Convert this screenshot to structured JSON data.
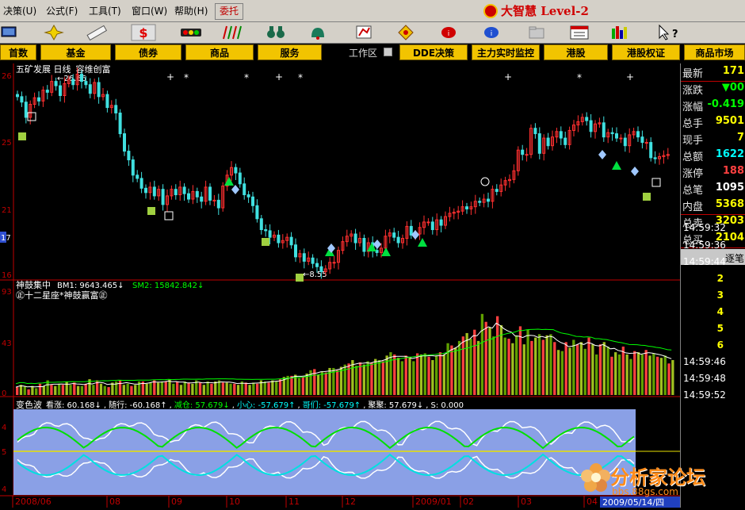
{
  "menu": {
    "items": [
      "决策(U)",
      "公式(F)",
      "工具(T)",
      "窗口(W)",
      "帮助(H)"
    ],
    "weituo": "委托",
    "brand": "大智慧 Level-2"
  },
  "toolbar": {
    "icons": [
      "monitor-icon",
      "cross-cursor-icon",
      "ruler-icon",
      "dollar-icon",
      "traffic-light-icon",
      "candle-bars-icon",
      "binoculars-icon",
      "bell-icon",
      "chart-tag-icon",
      "diamond-icon",
      "bubble-icon",
      "info-icon",
      "folder-icon",
      "window-icon",
      "color-bars-icon",
      "help-arrow-icon"
    ]
  },
  "nav": {
    "buttons": [
      "首数",
      "基金",
      "债券",
      "商品",
      "服务"
    ],
    "workspace": "工作区",
    "right_buttons": [
      "DDE决策",
      "主力实时监控",
      "港股",
      "港股权证",
      "商品市场"
    ]
  },
  "chart_data": [
    {
      "type": "candlestick",
      "title": "五矿发展 日线",
      "indicator": "容维创富",
      "annotations": [
        {
          "text": "←26.66",
          "note": "period high"
        },
        {
          "text": "←8.55",
          "note": "period low"
        }
      ],
      "price_axis_labels": [
        "26",
        "25",
        "21",
        "17",
        "16"
      ],
      "ylim": [
        8.0,
        27.5
      ],
      "closes": [
        24.6,
        24.1,
        22.7,
        23.9,
        24.5,
        24.2,
        25.2,
        25.0,
        26.0,
        25.6,
        24.7,
        25.8,
        26.2,
        25.7,
        26.66,
        26.0,
        25.7,
        24.9,
        25.9,
        24.6,
        24.8,
        23.6,
        23.8,
        23.1,
        21.2,
        19.6,
        18.8,
        17.4,
        17.1,
        16.2,
        15.8,
        16.3,
        15.5,
        16.1,
        14.7,
        15.5,
        16.1,
        15.6,
        16.3,
        15.7,
        15.2,
        15.9,
        15.4,
        15.0,
        16.3,
        15.1,
        15.1,
        14.4,
        16.4,
        17.4,
        18.1,
        17.6,
        16.6,
        15.6,
        15.4,
        14.6,
        13.4,
        12.4,
        12.3,
        11.7,
        11.9,
        11.2,
        11.4,
        11.7,
        11.0,
        9.9,
        10.2,
        9.5,
        9.8,
        9.3,
        9.0,
        8.55,
        8.8,
        9.4,
        9.4,
        10.5,
        11.3,
        11.8,
        12.0,
        11.2,
        11.6,
        10.4,
        11.2,
        10.5,
        10.3,
        10.7,
        11.8,
        12.1,
        11.7,
        11.2,
        11.6,
        12.7,
        11.9,
        12.0,
        12.6,
        13.1,
        13.1,
        12.4,
        13.3,
        12.8,
        13.6,
        13.9,
        14.0,
        14.1,
        14.5,
        14.3,
        14.5,
        15.0,
        14.9,
        15.2,
        15.0,
        16.1,
        15.9,
        16.5,
        16.9,
        17.0,
        17.8,
        19.7,
        19.3,
        19.3,
        21.7,
        21.2,
        19.4,
        20.8,
        20.1,
        20.9,
        21.4,
        20.8,
        20.2,
        21.5,
        22.0,
        22.3,
        22.7,
        22.4,
        21.4,
        22.1,
        22.2,
        20.9,
        21.3,
        21.2,
        20.8,
        20.8,
        20.1,
        21.1,
        21.4,
        20.9,
        20.4,
        20.4,
        19.0,
        18.9,
        19.1,
        19.2,
        19.3
      ],
      "buy_markers": [
        "square",
        "triangle",
        "diamond"
      ],
      "sell_markers": [
        "star",
        "cross"
      ]
    },
    {
      "type": "bar+line",
      "title": "神鼓集中",
      "legend": [
        {
          "text": "BM1: 9643.465↓",
          "color": "#ffffff"
        },
        {
          "text": "SM2: 15842.842↓",
          "color": "#00ff00"
        }
      ],
      "subtitle": "㊣十二星座*神鼓赢富㊣",
      "axis_labels": [
        "93",
        "43",
        "0"
      ],
      "volume": [
        7,
        9,
        8,
        5,
        8,
        6,
        10,
        8,
        13,
        9,
        8,
        10,
        9,
        12,
        9,
        11,
        8,
        8,
        10,
        14,
        9,
        13,
        10,
        8,
        7,
        11,
        12,
        13,
        9,
        10,
        8,
        9,
        12,
        12,
        10,
        11,
        13,
        11,
        12,
        12,
        14,
        10,
        12,
        9,
        12,
        11,
        10,
        13,
        11,
        9,
        12,
        10,
        12,
        13,
        11,
        11,
        10,
        10,
        9,
        12,
        11,
        9,
        11,
        10,
        13,
        12,
        11,
        13,
        12,
        14,
        16,
        17,
        17,
        18,
        15,
        16,
        19,
        22,
        23,
        18,
        21,
        20,
        24,
        24,
        22,
        25,
        27,
        28,
        31,
        26,
        29,
        27,
        30,
        29,
        32,
        31,
        30,
        35,
        38,
        36,
        33,
        30,
        35,
        34,
        30,
        37,
        36,
        37,
        34,
        31,
        35,
        38,
        36,
        46,
        44,
        42,
        48,
        52,
        55,
        50,
        58,
        48,
        72,
        65,
        60,
        52,
        70,
        62,
        51,
        50,
        46,
        53,
        61,
        45,
        58,
        48,
        51,
        54,
        49,
        53,
        54,
        47,
        40,
        39,
        47,
        42,
        49,
        45,
        47,
        41,
        51,
        45,
        36,
        45,
        47,
        43,
        34,
        38,
        36,
        43,
        36,
        32,
        39,
        38,
        36,
        40,
        35,
        37,
        34,
        33,
        35,
        28,
        31
      ]
    },
    {
      "type": "oscillator",
      "title": "变色波",
      "legend": [
        {
          "text": "看涨: 60.168↓",
          "color": "#ffffff"
        },
        {
          "text": "随行: -60.168↑",
          "color": "#ffffff"
        },
        {
          "text": "减仓: 57.679↓",
          "color": "#00ff00"
        },
        {
          "text": "小心: -57.679↑",
          "color": "#00ffff"
        },
        {
          "text": "哥们: -57.679↑",
          "color": "#00ffff"
        },
        {
          "text": "聚聚: 57.679↓",
          "color": "#ffffff"
        },
        {
          "text": "S: 0.000",
          "color": "#ffffff"
        }
      ],
      "axis_labels": [
        "4",
        "5",
        "4"
      ]
    }
  ],
  "x_axis": {
    "labels": [
      "2008/06",
      "08",
      "09",
      "10",
      "11",
      "12",
      "2009/01",
      "02",
      "03",
      "04"
    ],
    "current_date": "2009/05/14/四"
  },
  "quote_panel": {
    "rows": [
      {
        "label": "最新",
        "value": "171",
        "color": "#ffff00"
      },
      {
        "label": "涨跌",
        "value": "▼00",
        "color": "#00ff00"
      },
      {
        "label": "涨幅",
        "value": "-0.419",
        "color": "#00ff00"
      },
      {
        "label": "总手",
        "value": "9501",
        "color": "#ffff00"
      },
      {
        "label": "现手",
        "value": "7",
        "color": "#ffff00"
      },
      {
        "label": "总额",
        "value": "1622",
        "color": "#00ffff"
      },
      {
        "label": "涨停",
        "value": "188",
        "color": "#ff4040"
      },
      {
        "label": "总笔",
        "value": "1095",
        "color": "#ffffff"
      },
      {
        "label": "内盘",
        "value": "5368",
        "color": "#ffff00"
      },
      {
        "label": "总卖",
        "value": "3203",
        "color": "#ffff00"
      },
      {
        "label": "总买",
        "value": "2104",
        "color": "#ffff00"
      }
    ],
    "tick_header": "逐笔",
    "ticks": [
      {
        "time": "14:59:32",
        "vol": ""
      },
      {
        "time": "14:59:36",
        "vol": ""
      },
      {
        "time": "14:59:44",
        "vol": ""
      },
      {
        "time": "",
        "vol": "2"
      },
      {
        "time": "",
        "vol": "3"
      },
      {
        "time": "",
        "vol": "4"
      },
      {
        "time": "",
        "vol": "5"
      },
      {
        "time": "",
        "vol": "6"
      },
      {
        "time": "14:59:46",
        "vol": ""
      },
      {
        "time": "14:59:48",
        "vol": ""
      },
      {
        "time": "14:59:52",
        "vol": ""
      }
    ]
  },
  "watermark": {
    "text": "分析家论坛",
    "url": "bbs.88gs.com"
  }
}
